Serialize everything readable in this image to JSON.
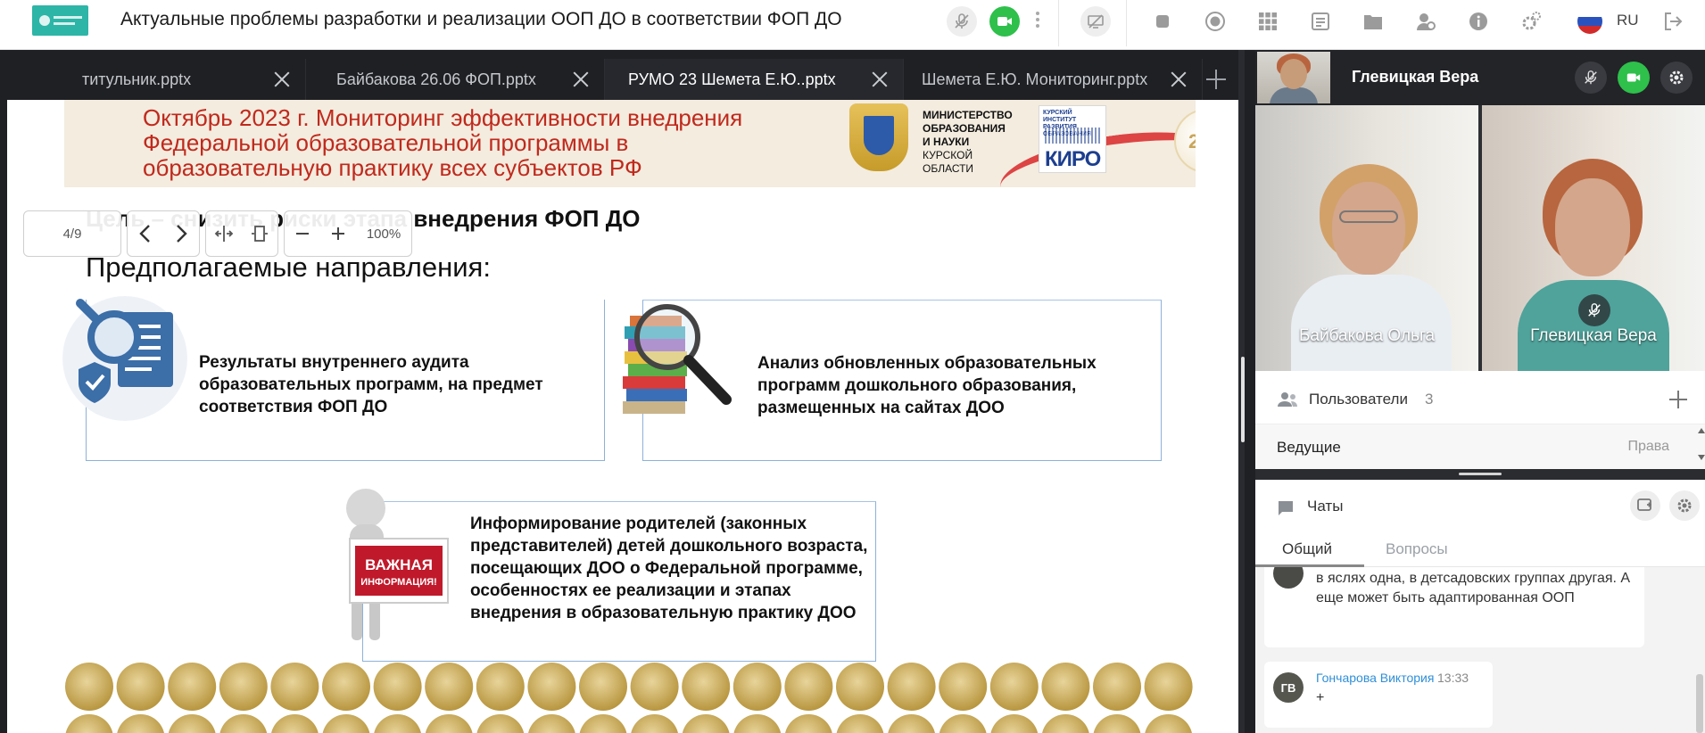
{
  "app": {
    "title": "Актуальные проблемы разработки и реализации ООП ДО в соответствии ФОП ДО",
    "language": "RU",
    "accent": "#2ec04b"
  },
  "tabs": [
    {
      "label": "титульник.pptx"
    },
    {
      "label": "Байбакова 26.06 ФОП.pptx"
    },
    {
      "label": "РУМО 23 Шемета Е.Ю..pptx"
    },
    {
      "label": "Шемета Е.Ю. Мониторинг.pptx"
    }
  ],
  "slide_toolbar": {
    "page": "4/9",
    "zoom": "100%"
  },
  "slide": {
    "header_lines": [
      "Октябрь 2023 г.  Мониторинг эффективности внедрения",
      "Федеральной образовательной программы  в",
      "образовательную практику всех субъектов РФ"
    ],
    "ministry_lines": [
      "МИНИСТЕРСТВО",
      "ОБРАЗОВАНИЯ",
      "И НАУКИ",
      "КУРСКОЙ",
      "ОБЛАСТИ"
    ],
    "kiro_caption": "КУРСКИЙ ИНСТИТУТ РАЗВИТИЯ ОБРАЗОВАНИЯ",
    "kiro_logo": "КИРО",
    "goal": "Цель – снизить риски этапа внедрения ФОП ДО",
    "directions": "Предполагаемые направления:",
    "card1": "Результаты внутреннего аудита образовательных программ, на предмет соответствия ФОП ДО",
    "card2": "Анализ обновленных образовательных программ дошкольного образования, размещенных на сайтах ДОО",
    "card3": "Информирование родителей (законных представителей) детей дошкольного возраста, посещающих ДОО о Федеральной программе, особенностях ее реализации и  этапах внедрения в образовательную практику ДОО",
    "sign_text_1": "ВАЖНАЯ",
    "sign_text_2": "ИНФОРМАЦИЯ!"
  },
  "speaker": {
    "name": "Глевицкая Вера"
  },
  "cameras": [
    {
      "name": "Байбакова Ольга"
    },
    {
      "name": "Глевицкая Вера",
      "muted": true
    }
  ],
  "users": {
    "label": "Пользователи",
    "count": "3",
    "section": "Ведущие",
    "rights": "Права"
  },
  "chat": {
    "label": "Чаты",
    "tabs": [
      "Общий",
      "Вопросы"
    ],
    "messages": [
      {
        "text": "в яслях одна, в детсадовских группах другая. А еще может быть адаптированная ООП"
      },
      {
        "initials": "ГВ",
        "author": "Гончарова Виктория",
        "time": "13:33",
        "text": "+"
      }
    ]
  }
}
